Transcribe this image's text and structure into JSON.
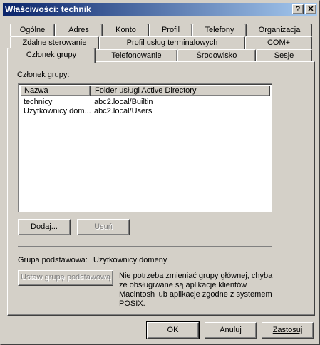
{
  "window": {
    "title": "Właściwości: technik",
    "help_button": "?",
    "close_button": "✕"
  },
  "tabs_row1": [
    "Ogólne",
    "Adres",
    "Konto",
    "Profil",
    "Telefony",
    "Organizacja"
  ],
  "tabs_row2": [
    "Zdalne sterowanie",
    "Profil usług terminalowych",
    "COM+"
  ],
  "tabs_row3": [
    "Członek grupy",
    "Telefonowanie",
    "Środowisko",
    "Sesje"
  ],
  "active_tab": "Członek grupy",
  "member_of": {
    "label": "Członek grupy:",
    "columns": [
      "Nazwa",
      "Folder usługi Active Directory"
    ],
    "rows": [
      {
        "name": "technicy",
        "folder": "abc2.local/Builtin"
      },
      {
        "name": "Użytkownicy dom...",
        "folder": "abc2.local/Users"
      }
    ]
  },
  "buttons": {
    "add": "Dodaj...",
    "remove": "Usuń",
    "set_primary": "Ustaw grupę podstawową",
    "ok": "OK",
    "cancel": "Anuluj",
    "apply": "Zastosuj"
  },
  "primary_group": {
    "label": "Grupa podstawowa:",
    "value": "Użytkownicy domeny",
    "note": "Nie potrzeba zmieniać grupy głównej, chyba że obsługiwane są aplikacje klientów Macintosh lub aplikacje zgodne z systemem POSIX."
  }
}
